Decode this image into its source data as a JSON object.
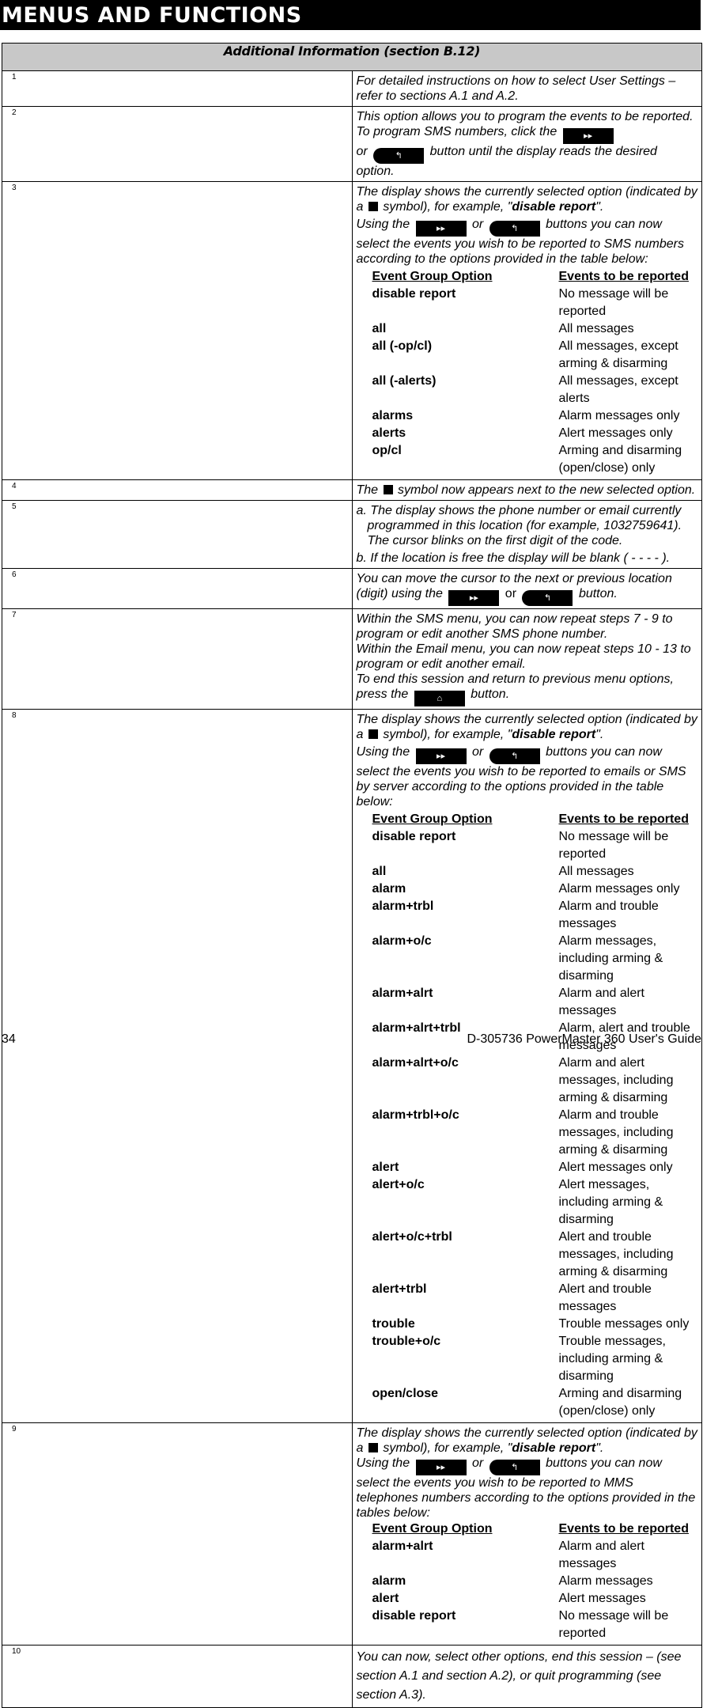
{
  "header": {
    "title": "MENUS AND FUNCTIONS"
  },
  "table_title": "Additional Information (section B.12)",
  "icons": {
    "next": "▸▸",
    "back": "↰",
    "home": "⌂"
  },
  "rows": {
    "r1": {
      "num": "1",
      "text": "For detailed instructions on how to select User Settings – refer to sections A.1 and A.2."
    },
    "r2": {
      "num": "2",
      "t1": "This option allows you to program the events to be reported. To program SMS numbers, click the",
      "t2": "or",
      "t3": "button until the display reads the desired option."
    },
    "r3": {
      "num": "3",
      "p1a": "The display shows the currently selected option (indicated by a",
      "p1b": "symbol), for example, \"",
      "p1c": "disable report",
      "p1d": "\".",
      "p2a": "Using the",
      "p2b": "or",
      "p2c": "buttons you can now select the events you wish to be reported to SMS numbers according to the options provided in the table below:",
      "header": [
        "Event Group Option",
        "Events to be reported"
      ],
      "options": [
        [
          "disable report",
          "No message will be reported"
        ],
        [
          "all",
          "All messages"
        ],
        [
          "all (-op/cl)",
          "All messages, except arming & disarming"
        ],
        [
          "all (-alerts)",
          "All messages, except alerts"
        ],
        [
          "alarms",
          "Alarm messages only"
        ],
        [
          "alerts",
          "Alert messages only"
        ],
        [
          "op/cl",
          "Arming and disarming (open/close) only"
        ]
      ]
    },
    "r4": {
      "num": "4",
      "a": "The",
      "b": "symbol now appears next to the new selected option."
    },
    "r5": {
      "num": "5",
      "a": "a. The display shows the phone number or email currently programmed in this location (for example, 1032759641). The cursor blinks on the first digit of the code.",
      "b": "b. If the location is free the display will be blank ( - - - - )."
    },
    "r6": {
      "num": "6",
      "a": "You can move the cursor to the next or previous location (digit) using the",
      "b": "or",
      "c": "button."
    },
    "r7": {
      "num": "7",
      "a": "Within the SMS menu, you can now repeat steps 7 - 9 to program or edit another SMS phone number.",
      "b": "Within the Email menu, you can now repeat steps 10 - 13 to program or edit another email.",
      "c": "To end this session and return to previous menu options, press the",
      "d": "button."
    },
    "r8": {
      "num": "8",
      "p1a": "The display shows the currently selected option (indicated by a",
      "p1b": "symbol), for example, \"",
      "p1c": "disable report",
      "p1d": "\".",
      "p2a": "Using the",
      "p2b": "or",
      "p2c": "buttons you can now select the events you wish to be reported to emails or SMS by server according to the options provided in the table below:",
      "header": [
        "Event Group Option",
        "Events to be reported"
      ],
      "options": [
        [
          "disable report",
          "No message will be reported"
        ],
        [
          "all",
          "All messages"
        ],
        [
          "alarm",
          "Alarm messages only"
        ],
        [
          "alarm+trbl",
          "Alarm and trouble messages"
        ],
        [
          "alarm+o/c",
          "Alarm messages, including arming & disarming"
        ],
        [
          "alarm+alrt",
          "Alarm and alert messages"
        ],
        [
          "alarm+alrt+trbl",
          "Alarm, alert and trouble messages"
        ],
        [
          "alarm+alrt+o/c",
          "Alarm and alert messages, including arming & disarming"
        ],
        [
          "alarm+trbl+o/c",
          "Alarm and trouble messages, including arming & disarming"
        ],
        [
          "alert",
          "Alert messages only"
        ],
        [
          "alert+o/c",
          "Alert messages, including arming & disarming"
        ],
        [
          "alert+o/c+trbl",
          "Alert and trouble messages, including arming & disarming"
        ],
        [
          "alert+trbl",
          "Alert and trouble messages"
        ],
        [
          "trouble",
          "Trouble messages only"
        ],
        [
          "trouble+o/c",
          "Trouble messages, including arming & disarming"
        ],
        [
          "open/close",
          "Arming and disarming (open/close) only"
        ]
      ]
    },
    "r9": {
      "num": "9",
      "p1a": "The display shows the currently selected option (indicated by a",
      "p1b": "symbol), for example, \"",
      "p1c": "disable report",
      "p1d": "\".",
      "p2a": "Using the",
      "p2b": "or",
      "p2c": "buttons you can now select the events you wish to be reported to MMS telephones numbers according to the options provided in the tables below:",
      "header": [
        "Event Group Option",
        "Events to be reported"
      ],
      "options": [
        [
          "alarm+alrt",
          "Alarm and alert messages"
        ],
        [
          "alarm",
          "Alarm messages"
        ],
        [
          "alert",
          "Alert messages"
        ],
        [
          "disable report",
          "No message will be reported"
        ]
      ]
    },
    "r10": {
      "num": "10",
      "text": "You can now, select other options, end this session – (see section A.1 and section A.2), or quit programming (see section A.3)."
    }
  },
  "footer": {
    "page": "34",
    "doc": "D-305736 PowerMaster 360 User's Guide"
  }
}
